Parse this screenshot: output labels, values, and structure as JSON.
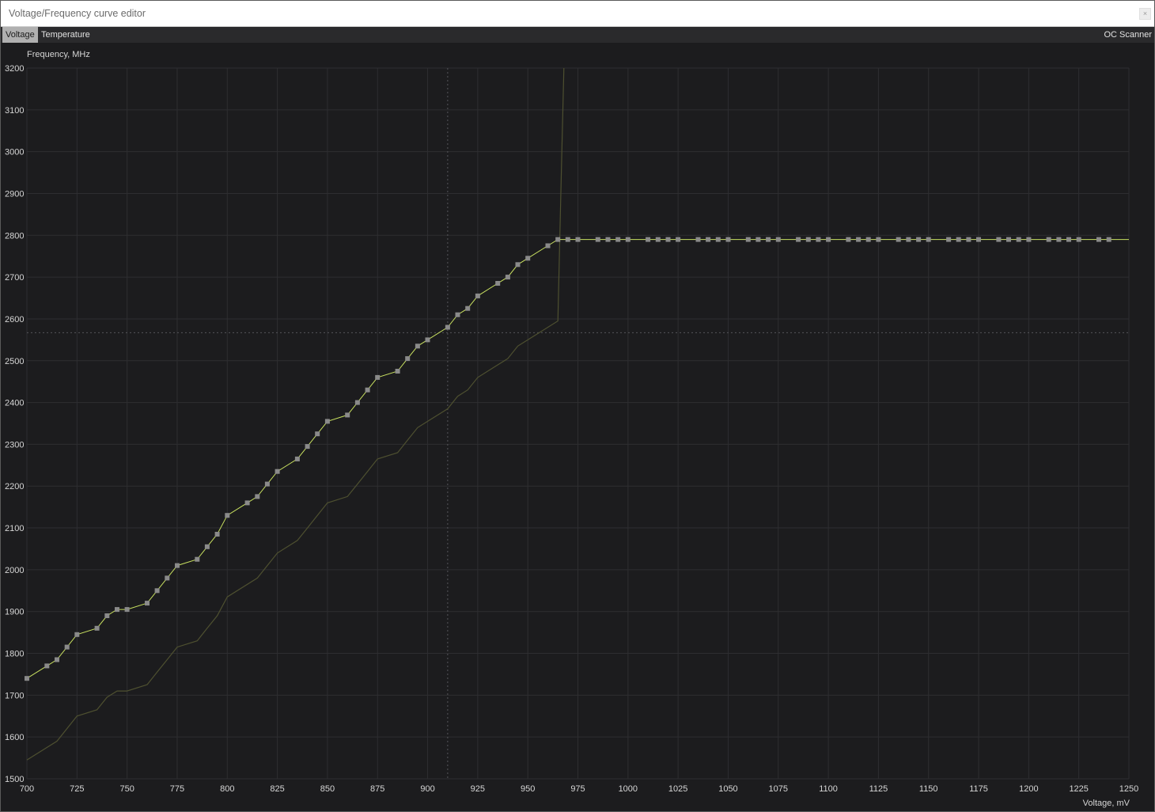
{
  "window": {
    "title": "Voltage/Frequency curve editor",
    "close_glyph": "×"
  },
  "tabs": [
    {
      "label": "Voltage",
      "active": true
    },
    {
      "label": "Temperature",
      "active": false
    }
  ],
  "oc_scanner_label": "OC Scanner",
  "colors": {
    "background": "#1c1c1e",
    "grid": "#2e2e31",
    "curve": "#c8e060",
    "base_curve": "#4e5030",
    "point": "#8a8a8a",
    "crosshair": "#55555a"
  },
  "chart_data": {
    "type": "line",
    "ylabel": "Frequency, MHz",
    "xlabel": "Voltage, mV",
    "xlim": [
      700,
      1250
    ],
    "ylim": [
      1500,
      3200
    ],
    "x_ticks": [
      700,
      725,
      750,
      775,
      800,
      825,
      850,
      875,
      900,
      925,
      950,
      975,
      1000,
      1025,
      1050,
      1075,
      1100,
      1125,
      1150,
      1175,
      1200,
      1225,
      1250
    ],
    "y_ticks": [
      1500,
      1600,
      1700,
      1800,
      1900,
      2000,
      2100,
      2200,
      2300,
      2400,
      2500,
      2600,
      2700,
      2800,
      2900,
      3000,
      3100,
      3200
    ],
    "grid": true,
    "crosshair": {
      "x": 910,
      "y": 2567
    },
    "series": [
      {
        "role": "curve",
        "points": [
          [
            700,
            1740
          ],
          [
            710,
            1770
          ],
          [
            715,
            1785
          ],
          [
            720,
            1815
          ],
          [
            725,
            1845
          ],
          [
            735,
            1860
          ],
          [
            740,
            1890
          ],
          [
            745,
            1905
          ],
          [
            750,
            1905
          ],
          [
            760,
            1920
          ],
          [
            765,
            1950
          ],
          [
            770,
            1980
          ],
          [
            775,
            2010
          ],
          [
            785,
            2025
          ],
          [
            790,
            2055
          ],
          [
            795,
            2085
          ],
          [
            800,
            2130
          ],
          [
            810,
            2160
          ],
          [
            815,
            2175
          ],
          [
            820,
            2205
          ],
          [
            825,
            2235
          ],
          [
            835,
            2265
          ],
          [
            840,
            2295
          ],
          [
            845,
            2325
          ],
          [
            850,
            2355
          ],
          [
            860,
            2370
          ],
          [
            865,
            2400
          ],
          [
            870,
            2430
          ],
          [
            875,
            2460
          ],
          [
            885,
            2475
          ],
          [
            890,
            2505
          ],
          [
            895,
            2535
          ],
          [
            900,
            2550
          ],
          [
            910,
            2580
          ],
          [
            915,
            2610
          ],
          [
            920,
            2625
          ],
          [
            925,
            2655
          ],
          [
            935,
            2685
          ],
          [
            940,
            2700
          ],
          [
            945,
            2730
          ],
          [
            950,
            2745
          ],
          [
            960,
            2775
          ],
          [
            965,
            2790
          ],
          [
            970,
            2790
          ],
          [
            975,
            2790
          ],
          [
            985,
            2790
          ],
          [
            990,
            2790
          ],
          [
            995,
            2790
          ],
          [
            1000,
            2790
          ],
          [
            1010,
            2790
          ],
          [
            1015,
            2790
          ],
          [
            1020,
            2790
          ],
          [
            1025,
            2790
          ],
          [
            1035,
            2790
          ],
          [
            1040,
            2790
          ],
          [
            1045,
            2790
          ],
          [
            1050,
            2790
          ],
          [
            1060,
            2790
          ],
          [
            1065,
            2790
          ],
          [
            1070,
            2790
          ],
          [
            1075,
            2790
          ],
          [
            1085,
            2790
          ],
          [
            1090,
            2790
          ],
          [
            1095,
            2790
          ],
          [
            1100,
            2790
          ],
          [
            1110,
            2790
          ],
          [
            1115,
            2790
          ],
          [
            1120,
            2790
          ],
          [
            1125,
            2790
          ],
          [
            1135,
            2790
          ],
          [
            1140,
            2790
          ],
          [
            1145,
            2790
          ],
          [
            1150,
            2790
          ],
          [
            1160,
            2790
          ],
          [
            1165,
            2790
          ],
          [
            1170,
            2790
          ],
          [
            1175,
            2790
          ],
          [
            1185,
            2790
          ],
          [
            1190,
            2790
          ],
          [
            1195,
            2790
          ],
          [
            1200,
            2790
          ],
          [
            1210,
            2790
          ],
          [
            1215,
            2790
          ],
          [
            1220,
            2790
          ],
          [
            1225,
            2790
          ],
          [
            1235,
            2790
          ],
          [
            1240,
            2790
          ]
        ],
        "extend_to_x": 1250
      },
      {
        "role": "base",
        "points": [
          [
            700,
            1545
          ],
          [
            715,
            1590
          ],
          [
            725,
            1650
          ],
          [
            735,
            1665
          ],
          [
            740,
            1695
          ],
          [
            745,
            1710
          ],
          [
            750,
            1710
          ],
          [
            760,
            1725
          ],
          [
            765,
            1755
          ],
          [
            770,
            1785
          ],
          [
            775,
            1815
          ],
          [
            785,
            1830
          ],
          [
            790,
            1860
          ],
          [
            795,
            1890
          ],
          [
            800,
            1935
          ],
          [
            815,
            1980
          ],
          [
            820,
            2010
          ],
          [
            825,
            2040
          ],
          [
            835,
            2070
          ],
          [
            840,
            2100
          ],
          [
            845,
            2130
          ],
          [
            850,
            2160
          ],
          [
            860,
            2175
          ],
          [
            865,
            2205
          ],
          [
            870,
            2235
          ],
          [
            875,
            2265
          ],
          [
            885,
            2280
          ],
          [
            890,
            2310
          ],
          [
            895,
            2340
          ],
          [
            900,
            2355
          ],
          [
            910,
            2385
          ],
          [
            915,
            2415
          ],
          [
            920,
            2430
          ],
          [
            925,
            2460
          ],
          [
            935,
            2490
          ],
          [
            940,
            2505
          ],
          [
            945,
            2535
          ],
          [
            950,
            2550
          ],
          [
            965,
            2595
          ],
          [
            966,
            2800
          ],
          [
            967,
            3000
          ],
          [
            968,
            3200
          ]
        ]
      }
    ]
  }
}
